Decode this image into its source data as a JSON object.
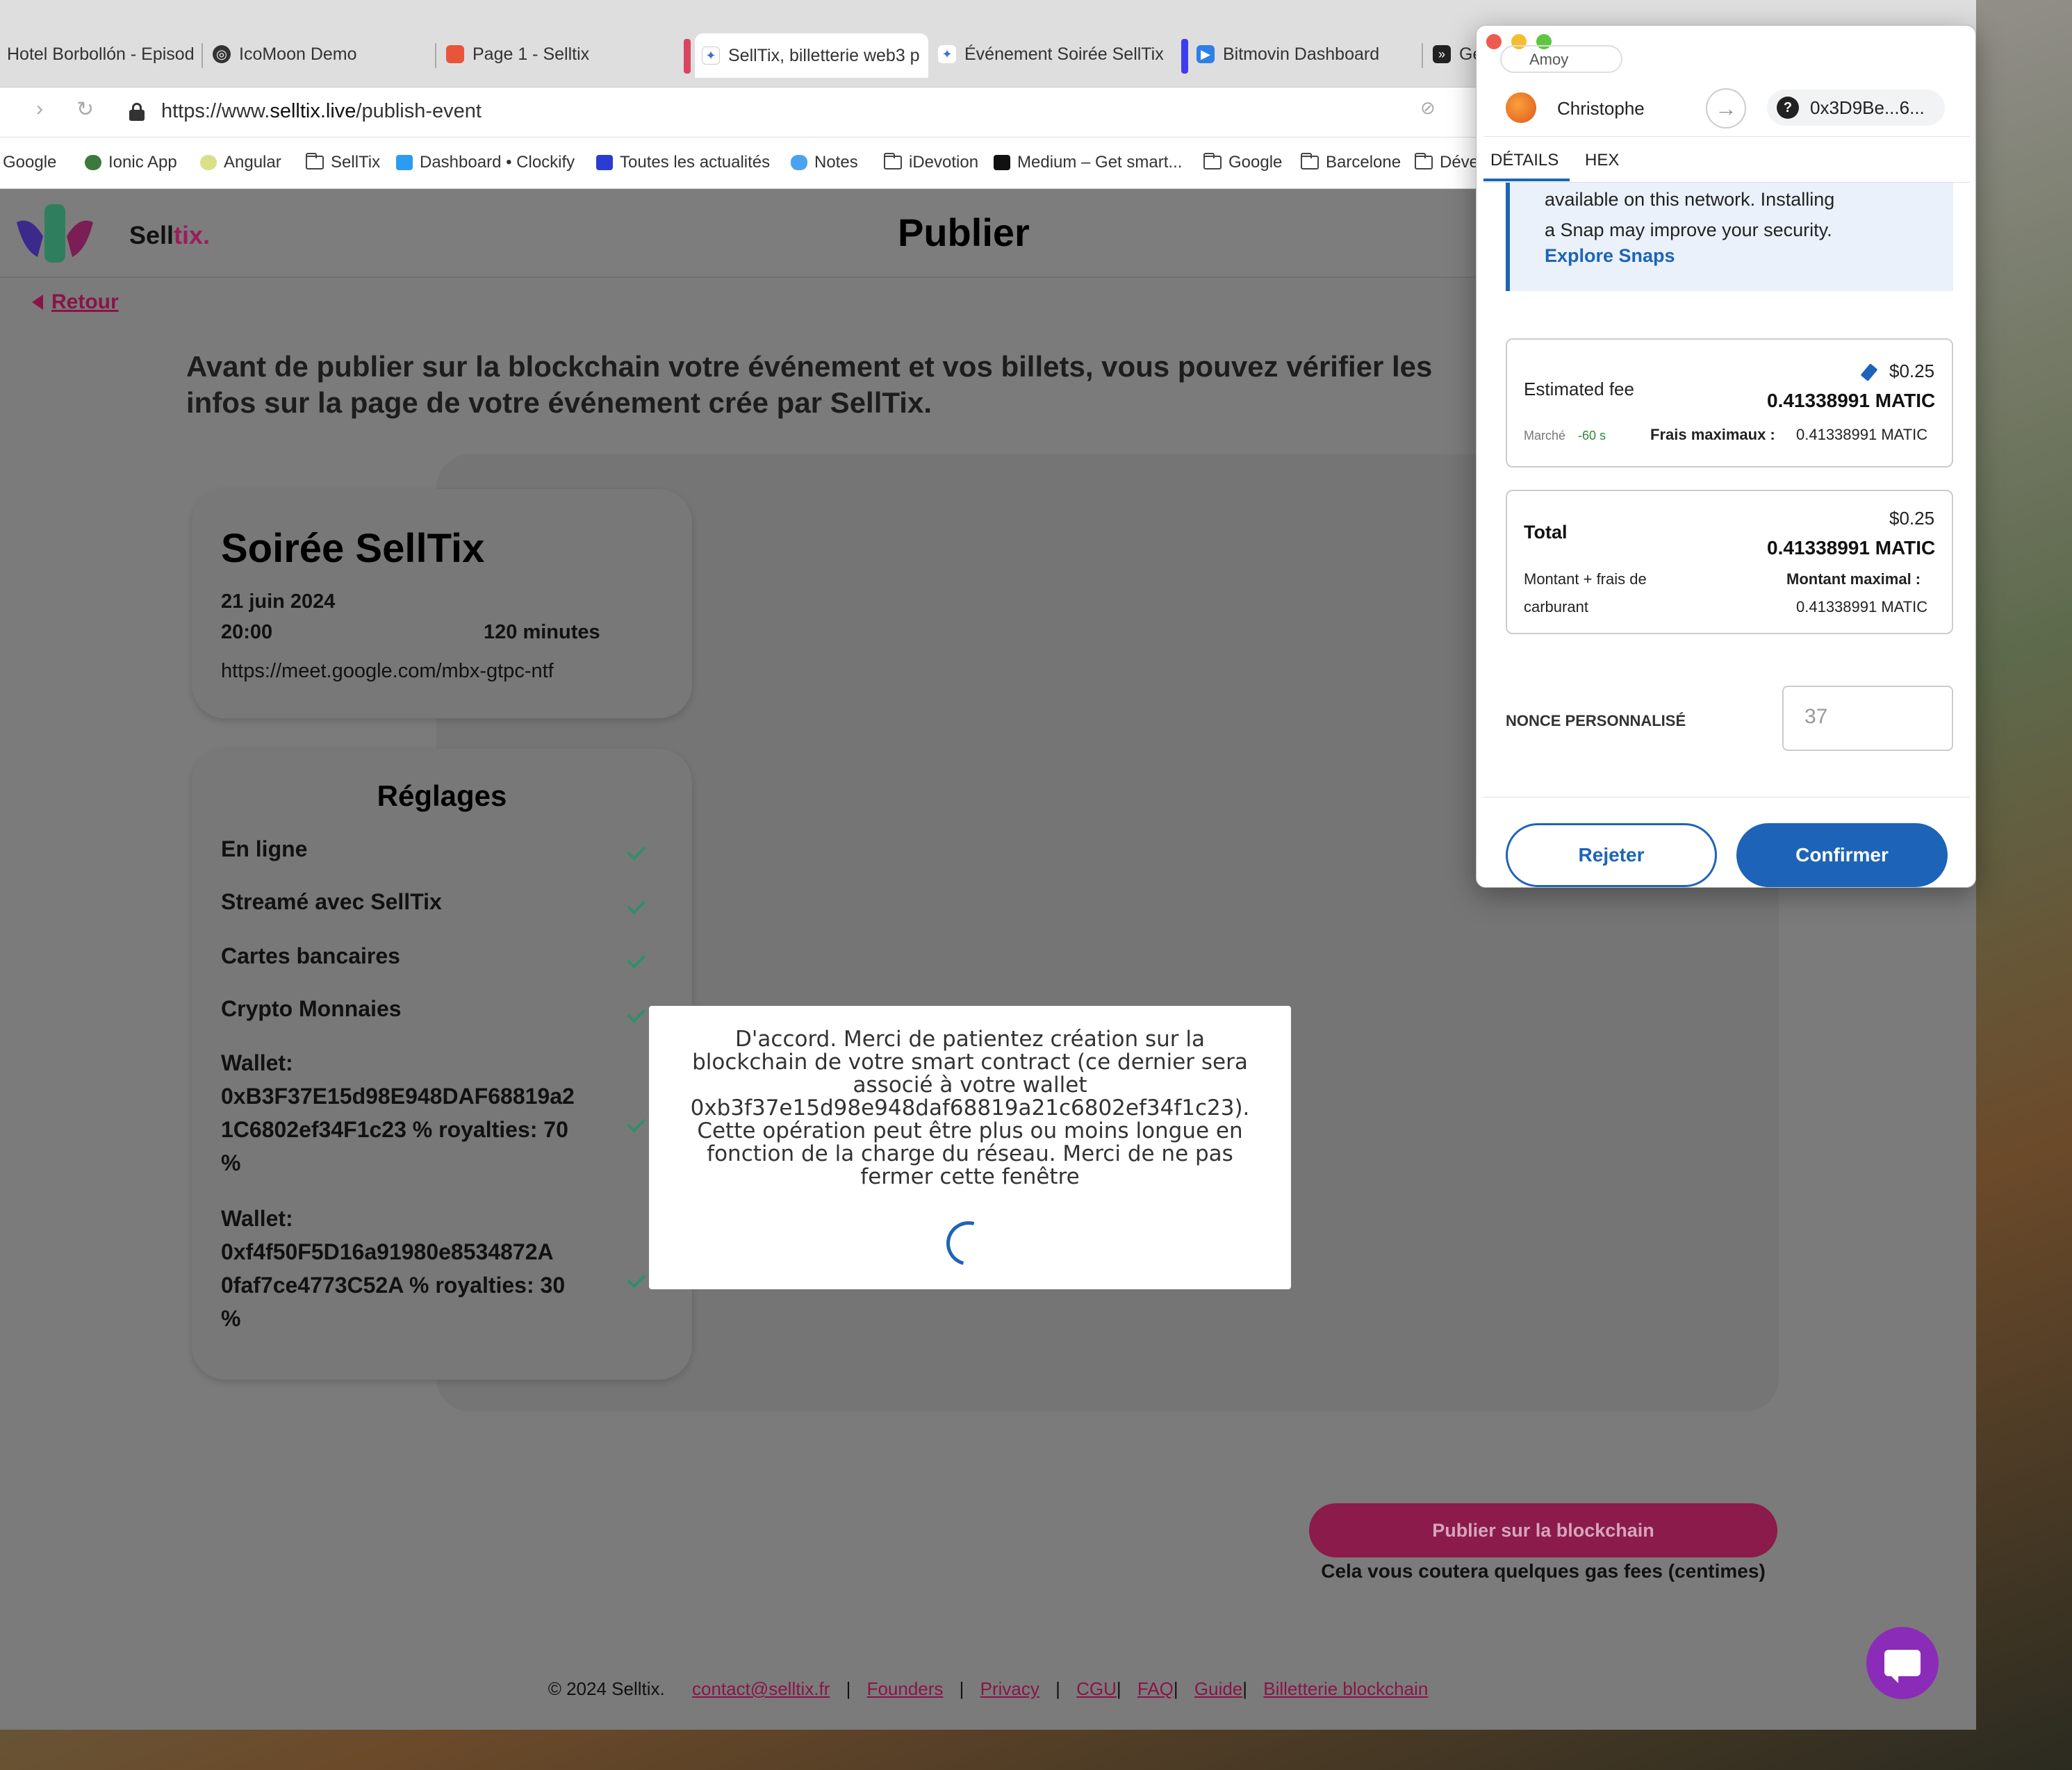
{
  "browser": {
    "tabs": [
      {
        "title": "Hotel Borbollón - Episod",
        "color": "#2a2a2a"
      },
      {
        "title": "IcoMoon Demo",
        "color": "#333333"
      },
      {
        "title": "Page 1 - Selltix",
        "color": "#e8553b"
      },
      {
        "title": "SellTix, billetterie web3 p",
        "color": "#3f6fd8"
      },
      {
        "title": "Événement Soirée SellTix",
        "color": "#3f6fd8"
      },
      {
        "title": "Bitmovin Dashboard",
        "color": "#2e7fe8"
      },
      {
        "title": "Ge",
        "color": "#222222"
      }
    ],
    "url_prefix": "https://www.",
    "url_domain": "selltix.live",
    "url_path": "/publish-event",
    "bookmarks": [
      "Google",
      "Ionic App",
      "Angular",
      "SellTix",
      "Dashboard • Clockify",
      "Toutes les actualités",
      "Notes",
      "iDevotion",
      "Medium – Get smart...",
      "Google",
      "Barcelone",
      "Déve"
    ]
  },
  "site": {
    "brand_main": "Sell",
    "brand_accent": "tix.",
    "page_title": "Publier",
    "back_label": "Retour",
    "intro": "Avant de publier sur la blockchain votre événement et vos billets, vous pouvez vérifier les infos sur la page de votre événement crée par SellTix.",
    "event": {
      "title": "Soirée SellTix",
      "date": "21 juin 2024",
      "time": "20:00",
      "duration": "120 minutes",
      "link": "https://meet.google.com/mbx-gtpc-ntf"
    },
    "settings": {
      "title": "Réglages",
      "online": "En ligne",
      "streamed": "Streamé avec SellTix",
      "cards": "Cartes bancaires",
      "crypto": "Crypto Monnaies",
      "wallet1_line1": "Wallet:",
      "wallet1_line2": "0xB3F37E15d98E948DAF68819a2",
      "wallet1_line3": "1C6802ef34F1c23 % royalties: 70",
      "wallet1_line4": "%",
      "wallet2_line1": "Wallet:",
      "wallet2_line2": "0xf4f50F5D16a91980e8534872A",
      "wallet2_line3": "0faf7ce4773C52A % royalties: 30",
      "wallet2_line4": "%"
    },
    "publish_button": "Publier sur la blockchain",
    "gas_note": "Cela vous coutera quelques gas fees (centimes)",
    "footer": {
      "copyright": "© 2024 Selltix.",
      "contact": "contact@selltix.fr",
      "founders": "Founders",
      "privacy": "Privacy",
      "cgu": "CGU",
      "faq": "FAQ",
      "guide": "Guide",
      "billetterie": "Billetterie blockchain"
    },
    "modal": {
      "line1": "D'accord. Merci de patientez création sur la",
      "line2": "blockchain de votre smart contract (ce dernier sera",
      "line3": "associé à votre wallet",
      "line4": "0xb3f37e15d98e948daf68819a21c6802ef34f1c23).",
      "line5": "Cette opération peut être plus ou moins longue en",
      "line6": "fonction de la charge du réseau. Merci de ne pas",
      "line7": "fermer cette fenêtre"
    }
  },
  "metamask": {
    "network_partial": "Amoy",
    "account_name": "Christophe",
    "destination": "0x3D9Be...6...",
    "tab_details": "DÉTAILS",
    "tab_hex": "HEX",
    "snap_line1": "available on this network. Installing",
    "snap_line2": "a Snap may improve your security.",
    "snap_link": "Explore Snaps",
    "fee_label": "Estimated fee",
    "fee_usd": "$0.25",
    "fee_matic": "0.41338991 MATIC",
    "market_label": "Marché",
    "market_time": "-60 s",
    "max_fee_label": "Frais maximaux :",
    "max_fee_value": "0.41338991 MATIC",
    "total_label": "Total",
    "total_usd": "$0.25",
    "total_matic": "0.41338991 MATIC",
    "amount_line1": "Montant + frais de",
    "amount_line2": "carburant",
    "max_amount_label": "Montant maximal :",
    "max_amount_value": "0.41338991 MATIC",
    "nonce_label": "NONCE PERSONNALISÉ",
    "nonce_placeholder": "37",
    "reject": "Rejeter",
    "confirm": "Confirmer"
  }
}
